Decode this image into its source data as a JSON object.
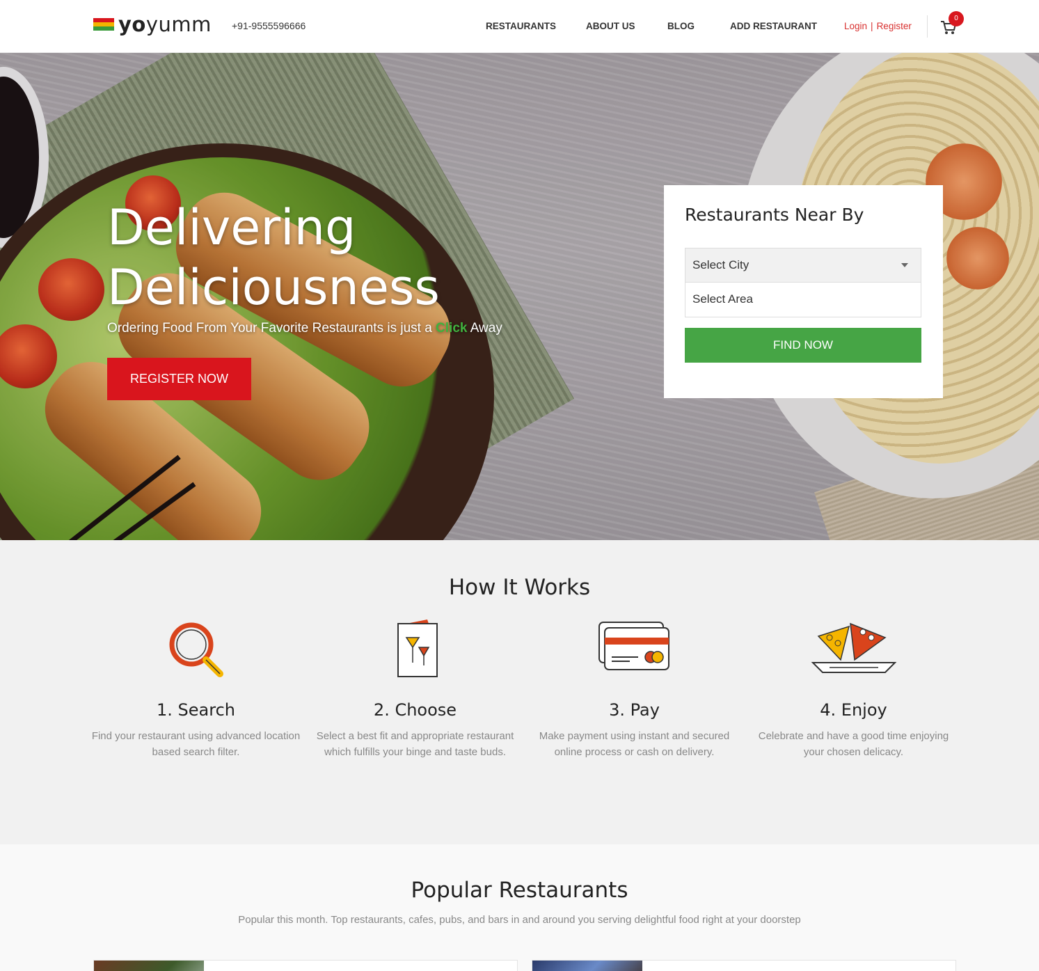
{
  "brand": {
    "name_bold": "yo",
    "name_rest": "yumm",
    "flag_colors": [
      "#d9151d",
      "#f4b400",
      "#3a9b3a"
    ]
  },
  "header": {
    "phone": "+91-9555596666",
    "nav": [
      "RESTAURANTS",
      "ABOUT US",
      "BLOG",
      "ADD RESTAURANT"
    ],
    "login": "Login",
    "separator": "|",
    "register": "Register",
    "cart_count": "0",
    "cart_icon": "cart-icon"
  },
  "hero": {
    "title_line1": "Delivering",
    "title_line2": "Deliciousness",
    "subtitle_before": "Ordering Food From Your Favorite Restaurants is just a ",
    "subtitle_highlight": "Click",
    "subtitle_after": " Away",
    "cta": "REGISTER NOW"
  },
  "search": {
    "title": "Restaurants Near By",
    "city_placeholder": "Select City",
    "area_placeholder": "Select Area",
    "button": "FIND NOW"
  },
  "how_it_works": {
    "title": "How It Works",
    "steps": [
      {
        "title": "1. Search",
        "text_line1": "Find your restaurant using advanced location",
        "text_line2": "based search filter.",
        "icon": "magnifier-icon"
      },
      {
        "title": "2. Choose",
        "text_line1": "Select a best fit and appropriate restaurant",
        "text_line2": "which fulfills your binge and taste buds.",
        "icon": "menu-card-icon"
      },
      {
        "title": "3. Pay",
        "text_line1": "Make payment using instant and secured",
        "text_line2": "online process or cash on delivery.",
        "icon": "credit-card-icon"
      },
      {
        "title": "4. Enjoy",
        "text_line1": "Celebrate and have a good time enjoying",
        "text_line2": "your chosen delicacy.",
        "icon": "pizza-plate-icon"
      }
    ]
  },
  "popular": {
    "title": "Popular Restaurants",
    "subtitle": "Popular this month. Top restaurants, cafes, pubs, and bars in and around you serving delightful food right at your doorstep"
  },
  "colors": {
    "accent_red": "#d9151d",
    "accent_green": "#46a545",
    "text_dark": "#222222",
    "text_muted": "#888888"
  }
}
